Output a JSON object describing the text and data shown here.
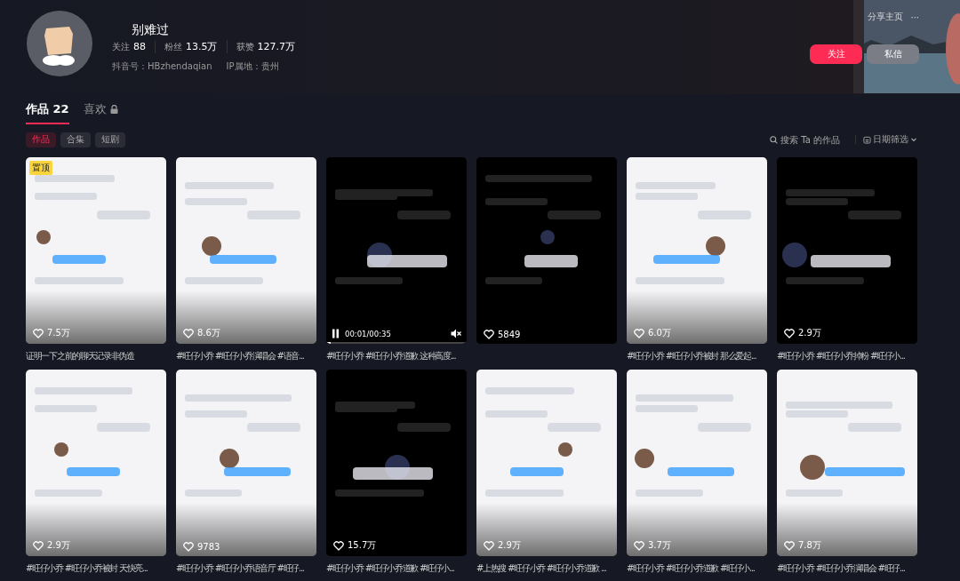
{
  "profile": {
    "name": "别难过",
    "stats": [
      {
        "label": "关注",
        "value": "88"
      },
      {
        "label": "粉丝",
        "value": "13.5万"
      },
      {
        "label": "获赞",
        "value": "127.7万"
      }
    ],
    "meta": [
      "抖音号：HBzhendaqian",
      "IP属地：贵州"
    ]
  },
  "actions": {
    "share": "分享主页",
    "more": "···",
    "follow": "关注",
    "message": "私信"
  },
  "tabs": [
    {
      "label": "作品",
      "count": "22",
      "selected": true,
      "locked": false
    },
    {
      "label": "喜欢",
      "selected": false,
      "locked": true
    }
  ],
  "subtabs": [
    {
      "label": "作品",
      "selected": true
    },
    {
      "label": "合集",
      "selected": false
    },
    {
      "label": "短剧",
      "selected": false
    }
  ],
  "search": {
    "placeholder": "搜索 Ta 的作品"
  },
  "date_filter": "日期筛选",
  "videos": [
    {
      "kind": "normal",
      "badge": "置顶",
      "likes": "7.5万",
      "caption": "证明一下之前的聊天记录非伪造"
    },
    {
      "kind": "normal",
      "likes": "8.6万",
      "caption": "#旺仔小乔 #旺仔小乔演唱会 #语音..."
    },
    {
      "kind": "playing",
      "time": "00:01/00:35",
      "level": 0.03,
      "caption": "#旺仔小乔 #旺仔小乔道歉 这种高度..."
    },
    {
      "kind": "normal",
      "likes": "5849"
    },
    {
      "kind": "normal",
      "likes": "6.0万",
      "caption": "#旺仔小乔 #旺仔小乔被封 那么爱起..."
    },
    {
      "kind": "normal",
      "likes": "2.9万",
      "caption": "#旺仔小乔 #旺仔小乔掉粉 #旺仔小..."
    },
    {
      "kind": "normal",
      "likes": "2.9万",
      "caption": "#旺仔小乔 #旺仔小乔被封 天快亮..."
    },
    {
      "kind": "normal",
      "likes": "9783",
      "caption": "#旺仔小乔 #旺仔小乔语音厅 #旺仔..."
    },
    {
      "kind": "normal",
      "likes": "15.7万",
      "caption": "#旺仔小乔 #旺仔小乔道歉 #旺仔小..."
    },
    {
      "kind": "normal",
      "likes": "2.9万",
      "caption": "#上热搜 #旺仔小乔 #旺仔小乔道歉 ..."
    },
    {
      "kind": "normal",
      "likes": "3.7万",
      "caption": "#旺仔小乔 #旺仔小乔道歉 #旺仔小..."
    },
    {
      "kind": "normal",
      "likes": "7.8万",
      "caption": "#旺仔小乔 #旺仔小乔演唱会 #旺仔..."
    }
  ]
}
